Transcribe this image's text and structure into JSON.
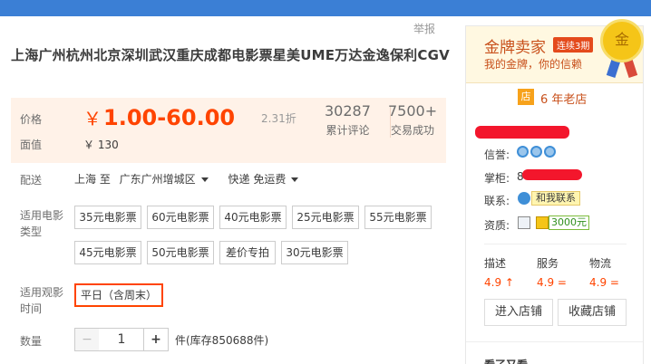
{
  "header": {
    "report_label": "举报"
  },
  "product": {
    "title": "上海广州杭州北京深圳武汉重庆成都电影票星美UME万达金逸保利CGV"
  },
  "price_box": {
    "price_label": "价格",
    "price_symbol": "￥",
    "price_range": "1.00-60.00",
    "discount": "2.31折",
    "face_label": "面值",
    "face_value": "￥ 130",
    "reviews_count": "30287",
    "reviews_label": "累计评论",
    "sales_count": "7500+",
    "sales_label": "交易成功"
  },
  "delivery": {
    "label": "配送",
    "from": "上海 至",
    "to": "广东广州增城区",
    "method": "快递 免运费"
  },
  "ticket_type": {
    "label": "适用电影类型",
    "options": [
      "35元电影票",
      "60元电影票",
      "40元电影票",
      "25元电影票",
      "55元电影票",
      "45元电影票",
      "50元电影票",
      "差价专拍",
      "30元电影票"
    ]
  },
  "viewing_time": {
    "label": "适用观影时间",
    "options": [
      "平日（含周末）"
    ],
    "selected": "平日（含周末）"
  },
  "quantity": {
    "label": "数量",
    "minus": "−",
    "value": "1",
    "plus": "+",
    "stock_text": "件(库存850688件)"
  },
  "shop": {
    "badge": "金牌卖家",
    "streak": "连续3期",
    "slogan": "我的金牌，你的信赖",
    "medal_text": "金",
    "shop_icon": "店",
    "years": "6 年老店",
    "credit_label": "信誉:",
    "owner_label": "掌柜:",
    "owner_visible": "8",
    "contact_label": "联系:",
    "contact_button": "和我联系",
    "qualification_label": "资质:",
    "cert_value": "3000元",
    "scores": [
      {
        "name": "描述",
        "value": "4.9 ↑"
      },
      {
        "name": "服务",
        "value": "4.9 ="
      },
      {
        "name": "物流",
        "value": "4.9 ="
      }
    ],
    "enter_button": "进入店铺",
    "favorite_button": "收藏店铺",
    "related_label": "看了又看",
    "colors": {
      "accent": "#ff4400",
      "gold_text": "#c8501b",
      "redaction": "#f3162c"
    }
  }
}
